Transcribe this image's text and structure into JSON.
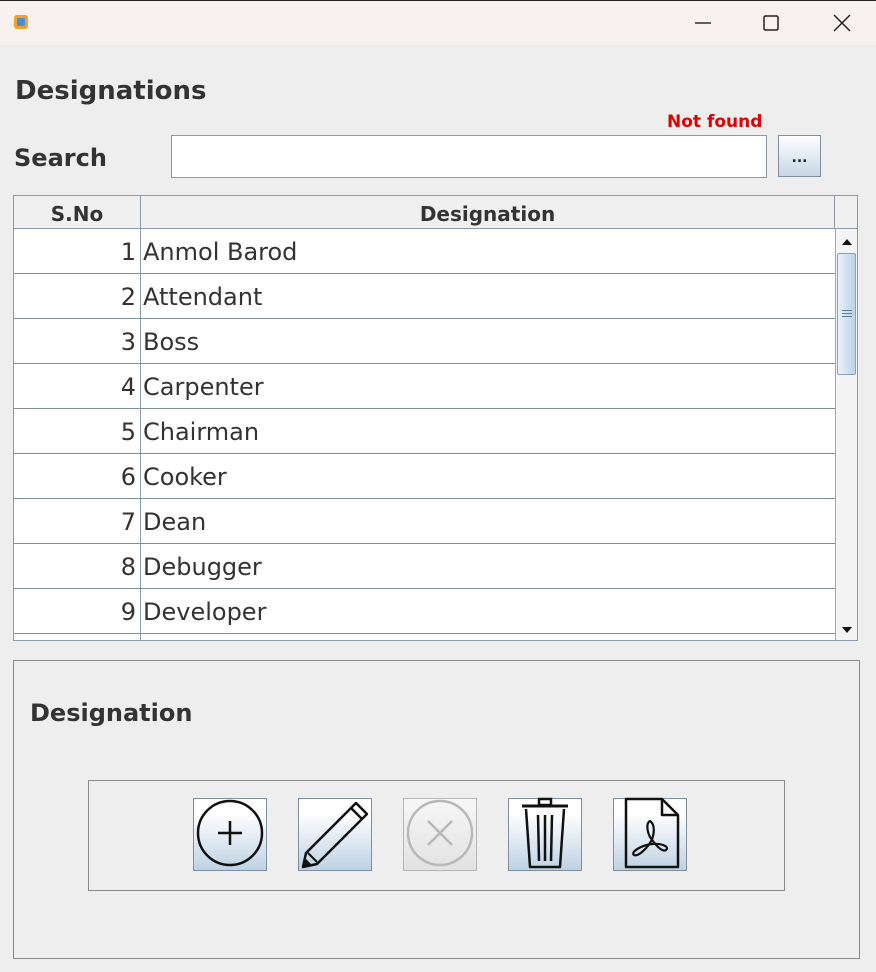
{
  "window": {
    "app_icon": "app-icon",
    "controls": [
      "minimize-icon",
      "maximize-icon",
      "close-icon"
    ]
  },
  "page": {
    "title": "Designations"
  },
  "search": {
    "label": "Search",
    "value": "",
    "status": "Not found",
    "browse_label": "..."
  },
  "table": {
    "columns": [
      "S.No",
      "Designation"
    ],
    "rows": [
      {
        "sno": "1",
        "designation": "Anmol Barod"
      },
      {
        "sno": "2",
        "designation": "Attendant"
      },
      {
        "sno": "3",
        "designation": "Boss"
      },
      {
        "sno": "4",
        "designation": "Carpenter"
      },
      {
        "sno": "5",
        "designation": "Chairman"
      },
      {
        "sno": "6",
        "designation": "Cooker"
      },
      {
        "sno": "7",
        "designation": "Dean"
      },
      {
        "sno": "8",
        "designation": "Debugger"
      },
      {
        "sno": "9",
        "designation": "Developer"
      },
      {
        "sno": "",
        "designation": ""
      }
    ]
  },
  "form": {
    "label": "Designation",
    "actions": [
      {
        "name": "add",
        "icon": "add-circle-icon",
        "enabled": true
      },
      {
        "name": "edit",
        "icon": "pencil-icon",
        "enabled": true
      },
      {
        "name": "cancel",
        "icon": "cancel-circle-icon",
        "enabled": false
      },
      {
        "name": "delete",
        "icon": "trash-icon",
        "enabled": true
      },
      {
        "name": "pdf",
        "icon": "pdf-icon",
        "enabled": true
      }
    ]
  },
  "colors": {
    "status_error": "#e00000",
    "button_gradient_bottom": "#bed2e4",
    "titlebar": "#f7f1ef"
  }
}
